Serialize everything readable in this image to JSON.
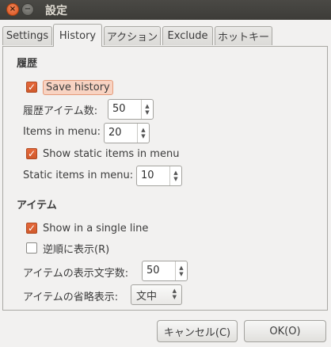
{
  "window": {
    "title": "設定",
    "close_glyph": "×",
    "minimize_glyph": "−"
  },
  "tabs": [
    {
      "label": "Settings",
      "active": false
    },
    {
      "label": "History",
      "active": true
    },
    {
      "label": "アクション",
      "active": false
    },
    {
      "label": "Exclude",
      "active": false
    },
    {
      "label": "ホットキー",
      "active": false
    }
  ],
  "history_section": {
    "heading": "履歴",
    "save_history": {
      "label": "Save history",
      "checked": true
    },
    "history_items": {
      "label": "履歴アイテム数:",
      "value": "50"
    },
    "items_in_menu": {
      "label": "Items in menu:",
      "value": "20"
    },
    "show_static": {
      "label": "Show static items in menu",
      "checked": true
    },
    "static_items": {
      "label": "Static items in menu:",
      "value": "10"
    }
  },
  "item_section": {
    "heading": "アイテム",
    "single_line": {
      "label": "Show in a single line",
      "checked": true
    },
    "reverse_order": {
      "label": "逆順に表示(R)",
      "checked": false
    },
    "chars_displayed": {
      "label": "アイテムの表示文字数:",
      "value": "50"
    },
    "ellipsize": {
      "label": "アイテムの省略表示:",
      "value": "文中"
    }
  },
  "buttons": {
    "cancel": "キャンセル(C)",
    "ok": "OK(O)"
  },
  "colors": {
    "accent": "#dd6232",
    "titlebar": "#3d3c38",
    "background": "#f2f1f0"
  }
}
